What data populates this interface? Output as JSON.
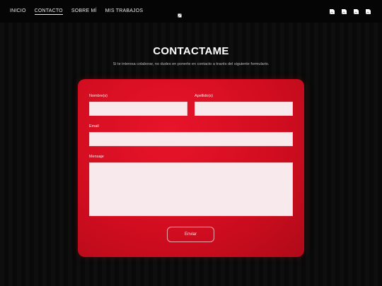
{
  "nav": {
    "links": [
      "INICIO",
      "CONTACTO",
      "SOBRE MÍ",
      "MIS TRABAJOS"
    ],
    "active_index": 1,
    "logo_icon": "broken-image-icon",
    "social_icons": [
      "broken-image-icon",
      "broken-image-icon",
      "broken-image-icon",
      "broken-image-icon"
    ]
  },
  "header": {
    "title": "CONTACTAME",
    "subtitle": "Si te interesa colaborar, no dudes en ponerte en contacto a través del siguiente formulario."
  },
  "form": {
    "first_name_label": "Nombre(s)",
    "first_name_value": "",
    "last_name_label": "Apellido(s)",
    "last_name_value": "",
    "email_label": "Email",
    "email_value": "",
    "message_label": "Mensaje",
    "message_value": "",
    "submit_label": "Enviar"
  },
  "colors": {
    "background": "#0b0b0b",
    "navbar": "#050505",
    "card": "#d20d20",
    "input": "#f8e9ec"
  }
}
